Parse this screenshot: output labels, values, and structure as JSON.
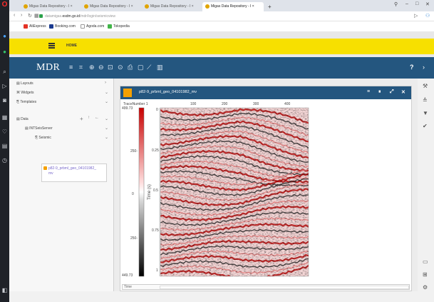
{
  "browser": {
    "tabs": [
      {
        "label": "Migas Data Repository - I",
        "active": false
      },
      {
        "label": "Migas Data Repository - I",
        "active": false
      },
      {
        "label": "Migas Data Repository - I",
        "active": false
      },
      {
        "label": "Migas Data Repository - I",
        "active": true
      }
    ],
    "new_tab": "+",
    "url_prefix": "datamigas.",
    "url_domain": "esdm.go.id",
    "url_path": "/mdr/login/seismicview",
    "bookmarks": [
      "AliExpress",
      "Booking.com",
      "Agoda.com",
      "Tokopedia"
    ]
  },
  "app": {
    "home_label": "HOME",
    "title": "MDR",
    "accent_yellow": "#f7e000",
    "accent_blue": "#24567f"
  },
  "sidebar": {
    "items": [
      {
        "label": "Layouts",
        "icon": "layouts-icon"
      },
      {
        "label": "Widgets",
        "icon": "widgets-icon"
      },
      {
        "label": "Templates",
        "icon": "templates-icon"
      },
      {
        "label": "Data",
        "icon": "data-icon"
      }
    ],
    "tree": {
      "level1": "INTSeisServer",
      "level2": "Seismic",
      "file_line1": "p82-9_prbml_geo_04101982_",
      "file_line2": "mv"
    }
  },
  "widget": {
    "title": "p82-9_prbml_geo_04101982_mv",
    "trace_label": "TraceNumber 1",
    "x_ticks": [
      "100",
      "200",
      "300",
      "400"
    ],
    "colorbar_top": "499.73",
    "colorbar_mid_upper": "250-",
    "colorbar_zero": "0",
    "colorbar_mid_lower": "250-",
    "colorbar_bottom": "449.73",
    "y_axis_label": "Time (s)",
    "y_ticks": [
      "0.25",
      "0.5",
      "0.75",
      "1"
    ],
    "y_zero": "0",
    "status_label": "Time"
  }
}
